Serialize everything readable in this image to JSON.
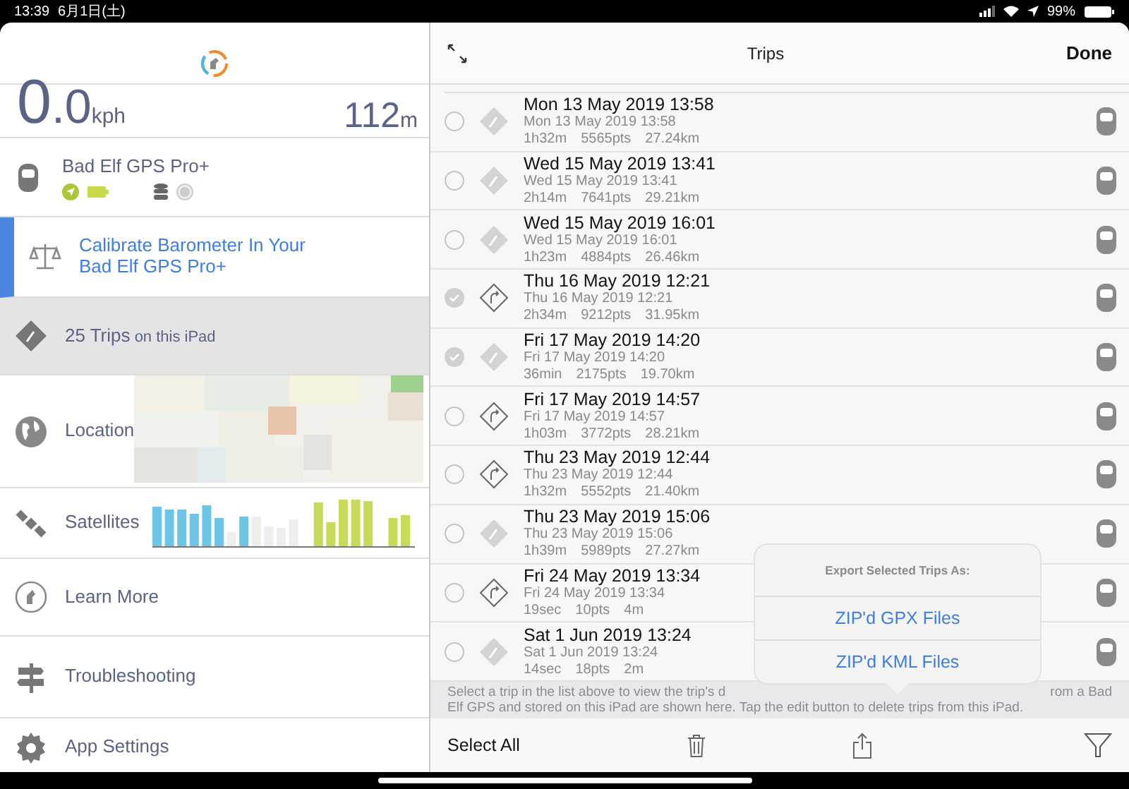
{
  "status_bar": {
    "time": "13:39",
    "date": "6月1日(土)",
    "battery": "99%"
  },
  "sidebar": {
    "speed": {
      "integer": "0",
      "decimal": ".0",
      "unit": "kph"
    },
    "altitude": {
      "value": "112",
      "unit": "m"
    },
    "device": {
      "name": "Bad Elf GPS Pro+"
    },
    "items": [
      {
        "kind": "calibrate",
        "label": "Calibrate Barometer In Your Bad Elf GPS Pro+",
        "selected": false
      },
      {
        "kind": "trips",
        "label": "25 Trips",
        "suffix": "on this iPad",
        "selected": true
      },
      {
        "kind": "location",
        "label": "Location",
        "selected": false
      },
      {
        "kind": "satellites",
        "label": "Satellites",
        "selected": false
      },
      {
        "kind": "learn",
        "label": "Learn More",
        "selected": false
      },
      {
        "kind": "troubleshooting",
        "label": "Troubleshooting",
        "selected": false
      },
      {
        "kind": "settings",
        "label": "App Settings",
        "selected": false
      }
    ]
  },
  "trips_panel": {
    "title": "Trips",
    "done": "Done",
    "rows": [
      {
        "selected": false,
        "kind": "filled",
        "title": "Mon 13 May 2019 13:58",
        "subtitle": "Mon 13 May 2019 13:58",
        "duration": "1h32m",
        "points": "5565pts",
        "distance": "27.24km"
      },
      {
        "selected": false,
        "kind": "filled",
        "title": "Wed 15 May 2019 13:41",
        "subtitle": "Wed 15 May 2019 13:41",
        "duration": "2h14m",
        "points": "7641pts",
        "distance": "29.21km"
      },
      {
        "selected": false,
        "kind": "filled",
        "title": "Wed 15 May 2019 16:01",
        "subtitle": "Wed 15 May 2019 16:01",
        "duration": "1h23m",
        "points": "4884pts",
        "distance": "26.46km"
      },
      {
        "selected": true,
        "kind": "outline",
        "title": "Thu 16 May 2019 12:21",
        "subtitle": "Thu 16 May 2019 12:21",
        "duration": "2h34m",
        "points": "9212pts",
        "distance": "31.95km"
      },
      {
        "selected": true,
        "kind": "filled",
        "title": "Fri 17 May 2019 14:20",
        "subtitle": "Fri 17 May 2019 14:20",
        "duration": "36min",
        "points": "2175pts",
        "distance": "19.70km"
      },
      {
        "selected": false,
        "kind": "outline",
        "title": "Fri 17 May 2019 14:57",
        "subtitle": "Fri 17 May 2019 14:57",
        "duration": "1h03m",
        "points": "3772pts",
        "distance": "28.21km"
      },
      {
        "selected": false,
        "kind": "outline",
        "title": "Thu 23 May 2019 12:44",
        "subtitle": "Thu 23 May 2019 12:44",
        "duration": "1h32m",
        "points": "5552pts",
        "distance": "21.40km"
      },
      {
        "selected": false,
        "kind": "filled",
        "title": "Thu 23 May 2019 15:06",
        "subtitle": "Thu 23 May 2019 15:06",
        "duration": "1h39m",
        "points": "5989pts",
        "distance": "27.27km"
      },
      {
        "selected": false,
        "kind": "outline",
        "title": "Fri 24 May 2019 13:34",
        "subtitle": "Fri 24 May 2019 13:34",
        "duration": "19sec",
        "points": "10pts",
        "distance": "4m"
      },
      {
        "selected": false,
        "kind": "filled",
        "title": "Sat 1 Jun 2019 13:24",
        "subtitle": "Sat 1 Jun 2019 13:24",
        "duration": "14sec",
        "points": "18pts",
        "distance": "2m"
      }
    ],
    "footer": {
      "line_1_start": "Select a trip in the list above to view the trip's d",
      "line_1_end": "rom a Bad",
      "line_2": "Elf GPS and stored on this iPad are shown here. Tap the edit button to delete trips from this iPad."
    },
    "toolbar": {
      "select_all": "Select All"
    },
    "export_popover": {
      "title": "Export Selected Trips As:",
      "options": [
        "ZIP'd GPX Files",
        "ZIP'd KML Files"
      ]
    }
  }
}
